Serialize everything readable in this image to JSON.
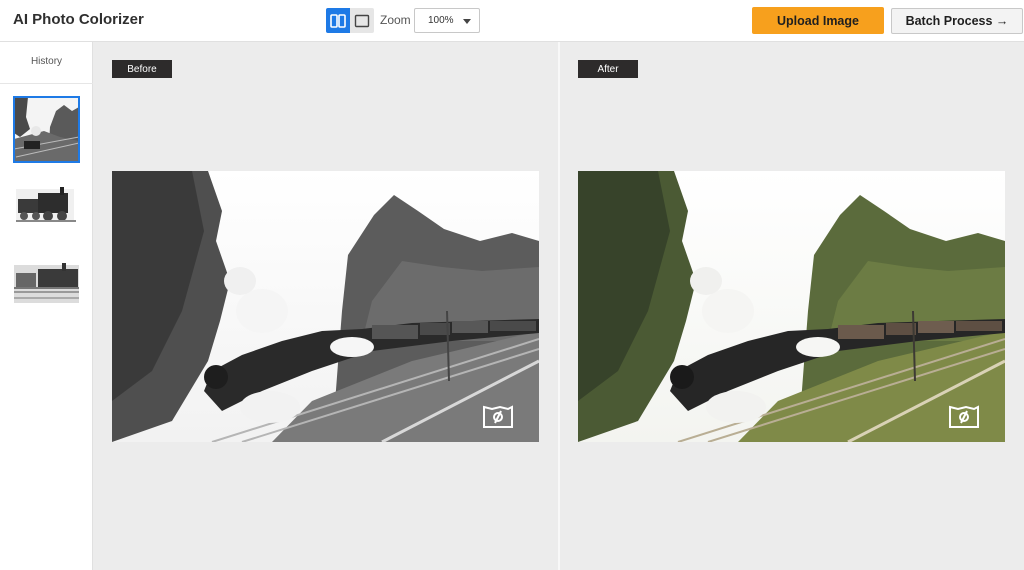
{
  "app": {
    "title": "AI Photo Colorizer"
  },
  "toolbar": {
    "zoom_label": "Zoom",
    "zoom_value": "100%",
    "upload_label": "Upload Image",
    "batch_label": "Batch Process →"
  },
  "sidebar": {
    "history_label": "History",
    "items": [
      {
        "name": "history-thumb-mountain",
        "selected": true
      },
      {
        "name": "history-thumb-locomotive",
        "selected": false
      },
      {
        "name": "history-thumb-train-yard",
        "selected": false
      }
    ]
  },
  "panes": {
    "before_label": "Before",
    "after_label": "After"
  },
  "colors": {
    "accent": "#1e7ae6",
    "upload": "#f7a01d",
    "tag_bg": "#2d2b2b",
    "canvas_bg": "#ececec"
  },
  "icons": [
    "split-view-icon",
    "single-view-icon",
    "chevron-down-icon",
    "colorize-badge-icon"
  ]
}
